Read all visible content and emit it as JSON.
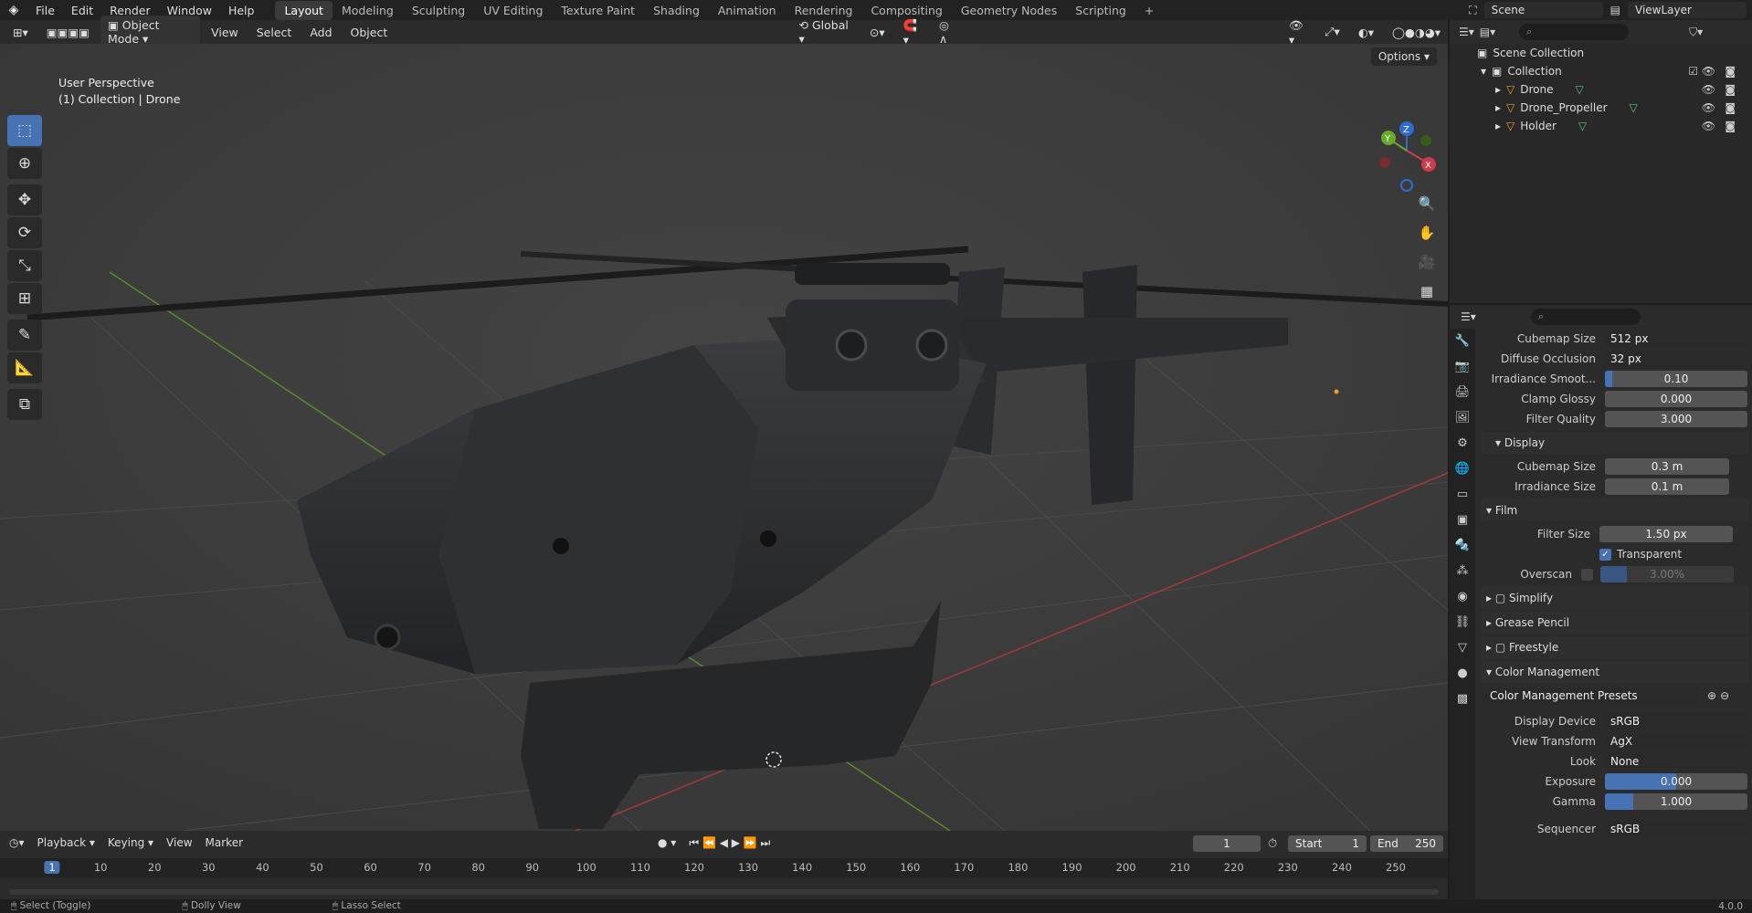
{
  "topbar": {
    "menu": [
      "File",
      "Edit",
      "Render",
      "Window",
      "Help"
    ],
    "workspaces": [
      "Layout",
      "Modeling",
      "Sculpting",
      "UV Editing",
      "Texture Paint",
      "Shading",
      "Animation",
      "Rendering",
      "Compositing",
      "Geometry Nodes",
      "Scripting",
      "+"
    ],
    "active_workspace": "Layout",
    "scene": "Scene",
    "view_layer": "ViewLayer"
  },
  "viewport_header": {
    "mode": "Object Mode",
    "menus": [
      "View",
      "Select",
      "Add",
      "Object"
    ],
    "orientation": "Global",
    "options": "Options"
  },
  "viewport": {
    "perspective": "User Perspective",
    "collection": "(1) Collection | Drone"
  },
  "outliner": {
    "root": "Scene Collection",
    "collection": "Collection",
    "items": [
      "Drone",
      "Drone_Propeller",
      "Holder"
    ]
  },
  "properties": {
    "rows_top": [
      {
        "label": "Cubemap Size",
        "value": "512 px",
        "type": "dropdown"
      },
      {
        "label": "Diffuse Occlusion",
        "value": "32 px",
        "type": "dropdown"
      },
      {
        "label": "Irradiance Smoot...",
        "value": "0.10",
        "fill": 0.05
      },
      {
        "label": "Clamp Glossy",
        "value": "0.000"
      },
      {
        "label": "Filter Quality",
        "value": "3.000"
      }
    ],
    "display_section": "Display",
    "display_rows": [
      {
        "label": "Cubemap Size",
        "value": "0.3 m"
      },
      {
        "label": "Irradiance Size",
        "value": "0.1 m"
      }
    ],
    "film_section": "Film",
    "filter_size": {
      "label": "Filter Size",
      "value": "1.50 px"
    },
    "transparent": "Transparent",
    "overscan": {
      "label": "Overscan",
      "value": "3.00%"
    },
    "collapsed_sections": [
      "Simplify",
      "Grease Pencil",
      "Freestyle"
    ],
    "color_management": "Color Management",
    "presets": "Color Management Presets",
    "cm_rows": [
      {
        "label": "Display Device",
        "value": "sRGB",
        "type": "dropdown"
      },
      {
        "label": "View Transform",
        "value": "AgX",
        "type": "dropdown"
      },
      {
        "label": "Look",
        "value": "None",
        "type": "dropdown"
      },
      {
        "label": "Exposure",
        "value": "0.000",
        "fill": 0.5
      },
      {
        "label": "Gamma",
        "value": "1.000",
        "fill": 0.2
      },
      {
        "label": "Sequencer",
        "value": "sRGB",
        "type": "dropdown"
      }
    ]
  },
  "timeline": {
    "menus": [
      "Playback",
      "Keying",
      "View",
      "Marker"
    ],
    "current_frame": "1",
    "start_label": "Start",
    "start": "1",
    "end_label": "End",
    "end": "250",
    "ticks": [
      "1",
      "10",
      "20",
      "30",
      "40",
      "50",
      "60",
      "70",
      "80",
      "90",
      "100",
      "110",
      "120",
      "130",
      "140",
      "150",
      "160",
      "170",
      "180",
      "190",
      "200",
      "210",
      "220",
      "230",
      "240",
      "250"
    ]
  },
  "status": {
    "items": [
      "Select (Toggle)",
      "Dolly View",
      "Lasso Select"
    ],
    "version": "4.0.0"
  }
}
